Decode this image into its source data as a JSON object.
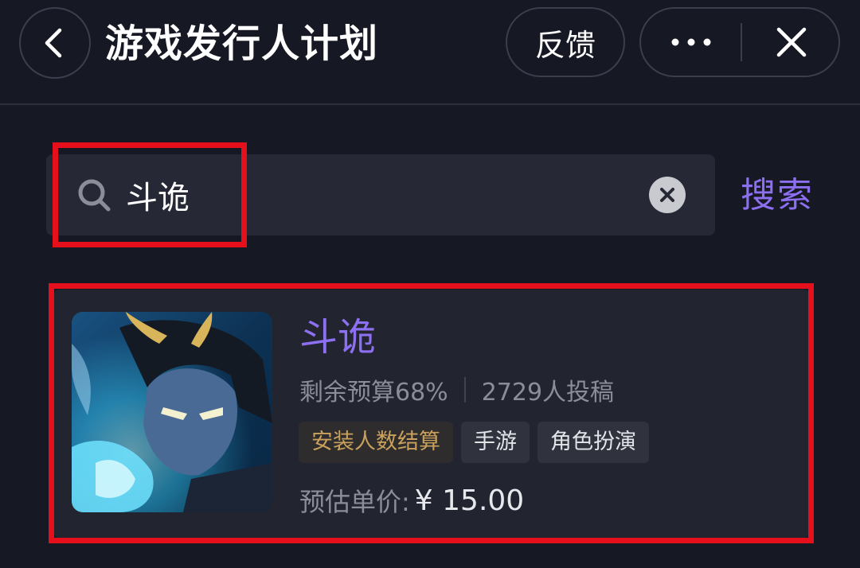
{
  "header": {
    "back_icon": "chevron-left-icon",
    "title": "游戏发行人计划",
    "feedback_label": "反馈",
    "more_icon": "more-dots-icon",
    "close_icon": "close-icon"
  },
  "search": {
    "query": "斗诡",
    "search_icon": "search-icon",
    "clear_icon": "clear-circle-icon",
    "action_label": "搜索"
  },
  "result": {
    "title": "斗诡",
    "budget_text": "剩余预算68%",
    "submissions_text": "2729人投稿",
    "tags": [
      "安装人数结算",
      "手游",
      "角色扮演"
    ],
    "price_label": "预估单价:",
    "price_value": "¥ 15.00",
    "cover_image": "game-cover-art"
  },
  "colors": {
    "background": "#161824",
    "accent_purple": "#8d6ff2",
    "highlight_red": "#e5101c",
    "tag_gold": "#c9a15c"
  }
}
